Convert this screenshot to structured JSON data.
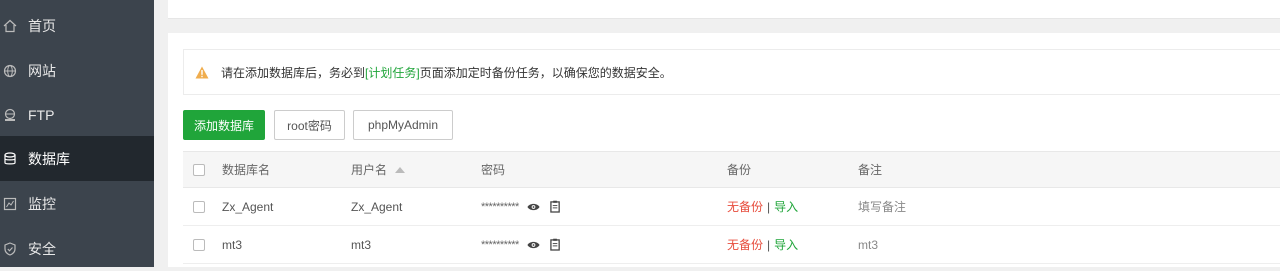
{
  "sidebar": {
    "items": [
      {
        "label": "首页",
        "icon": "home-icon",
        "active": false
      },
      {
        "label": "网站",
        "icon": "globe-icon",
        "active": false
      },
      {
        "label": "FTP",
        "icon": "ftp-icon",
        "active": false
      },
      {
        "label": "数据库",
        "icon": "database-icon",
        "active": true
      },
      {
        "label": "监控",
        "icon": "monitor-icon",
        "active": false
      },
      {
        "label": "安全",
        "icon": "shield-icon",
        "active": false
      }
    ]
  },
  "notice": {
    "prefix": "请在添加数据库后，务必到",
    "link": "[计划任务]",
    "suffix": "页面添加定时备份任务，以确保您的数据安全。"
  },
  "toolbar": {
    "add_label": "添加数据库",
    "root_label": "root密码",
    "pma_label": "phpMyAdmin"
  },
  "table": {
    "headers": {
      "name": "数据库名",
      "user": "用户名",
      "password": "密码",
      "backup": "备份",
      "note": "备注"
    },
    "rows": [
      {
        "name": "Zx_Agent",
        "user": "Zx_Agent",
        "password": "**********",
        "backup": "无备份",
        "sep": "|",
        "import": "导入",
        "note": "填写备注"
      },
      {
        "name": "mt3",
        "user": "mt3",
        "password": "**********",
        "backup": "无备份",
        "sep": "|",
        "import": "导入",
        "note": "mt3"
      }
    ]
  },
  "colors": {
    "sidebar_bg": "#3c444d",
    "sidebar_active": "#22282e",
    "accent_green": "#20a53a",
    "warning_red": "#e74c3c",
    "warning_orange": "#f0ad4e"
  }
}
